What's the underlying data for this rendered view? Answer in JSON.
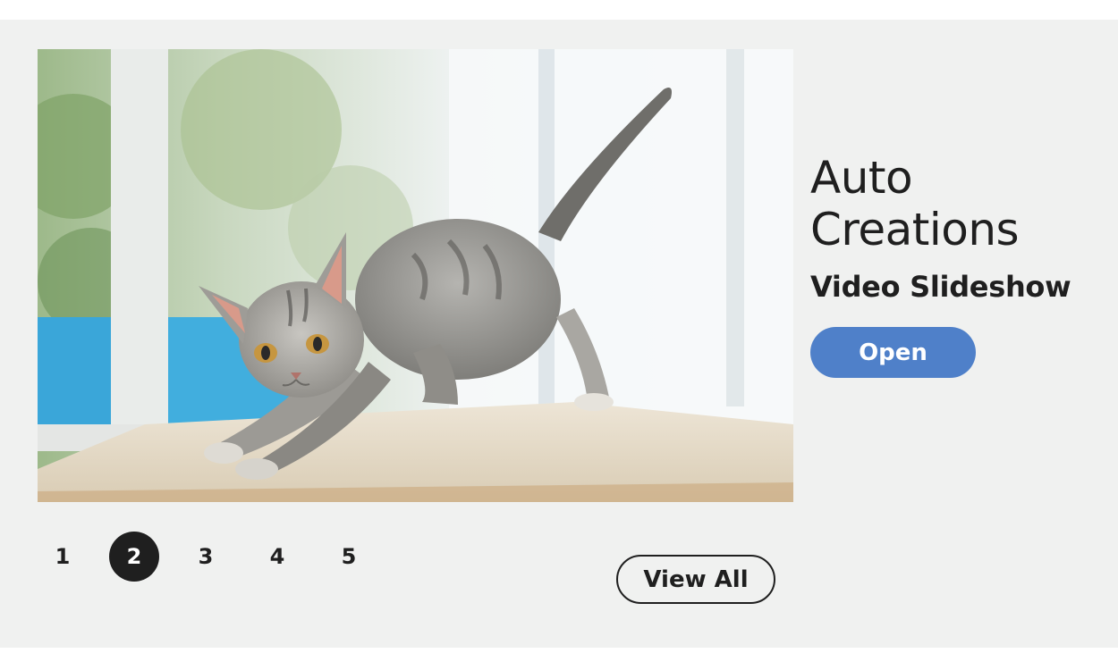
{
  "feature": {
    "title_line1": "Auto",
    "title_line2": "Creations",
    "subtitle": "Video Slideshow",
    "open_label": "Open",
    "image_subject": "kitten-photo"
  },
  "pagination": {
    "pages": [
      "1",
      "2",
      "3",
      "4",
      "5"
    ],
    "active_index": 1
  },
  "view_all_label": "View All",
  "colors": {
    "panel_bg": "#f0f1f0",
    "accent": "#4f80c9",
    "text": "#1f1f1f",
    "active_page_bg": "#1f1f1f"
  }
}
